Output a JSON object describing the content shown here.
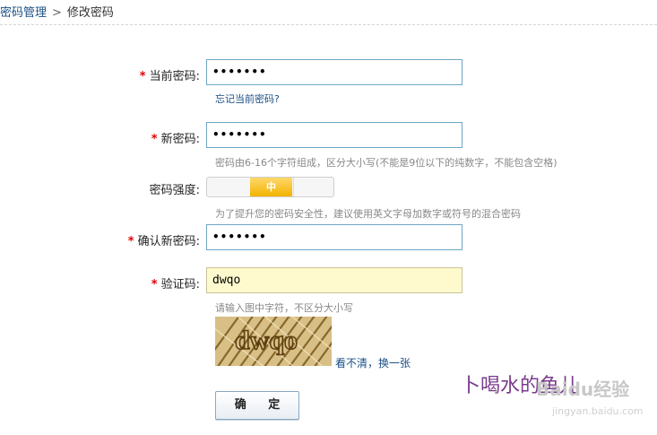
{
  "breadcrumb": {
    "parent": "密码管理",
    "separator": ">",
    "current": "修改密码"
  },
  "form": {
    "required_mark": "*",
    "current_password": {
      "label": "当前密码:",
      "value": "•••••••",
      "forgot_link": "忘记当前密码?"
    },
    "new_password": {
      "label": "新密码:",
      "value": "•••••••",
      "hint": "密码由6-16个字符组成，区分大小写(不能是9位以下的纯数字，不能包含空格)"
    },
    "strength": {
      "label": "密码强度:",
      "level": "中",
      "level_index": 2,
      "levels_total": 3,
      "hint": "为了提升您的密码安全性，建议使用英文字母加数字或符号的混合密码"
    },
    "confirm_password": {
      "label": "确认新密码:",
      "value": "•••••••"
    },
    "captcha": {
      "label": "验证码:",
      "value": "dwqo",
      "hint": "请输入图中字符，不区分大小写",
      "image_text": "dwqo",
      "refresh_link": "看不清，换一张"
    },
    "submit_label": "确  定"
  },
  "watermark": {
    "author": "卜喝水的鱼儿",
    "logo": "Baidu经验",
    "url": "jingyan.baidu.com"
  },
  "colors": {
    "field_border": "#6fa6c6",
    "required": "#e00000",
    "link": "#1a4f85",
    "captcha_bg": "#fffacd",
    "strength_mid": "#f2b200"
  }
}
